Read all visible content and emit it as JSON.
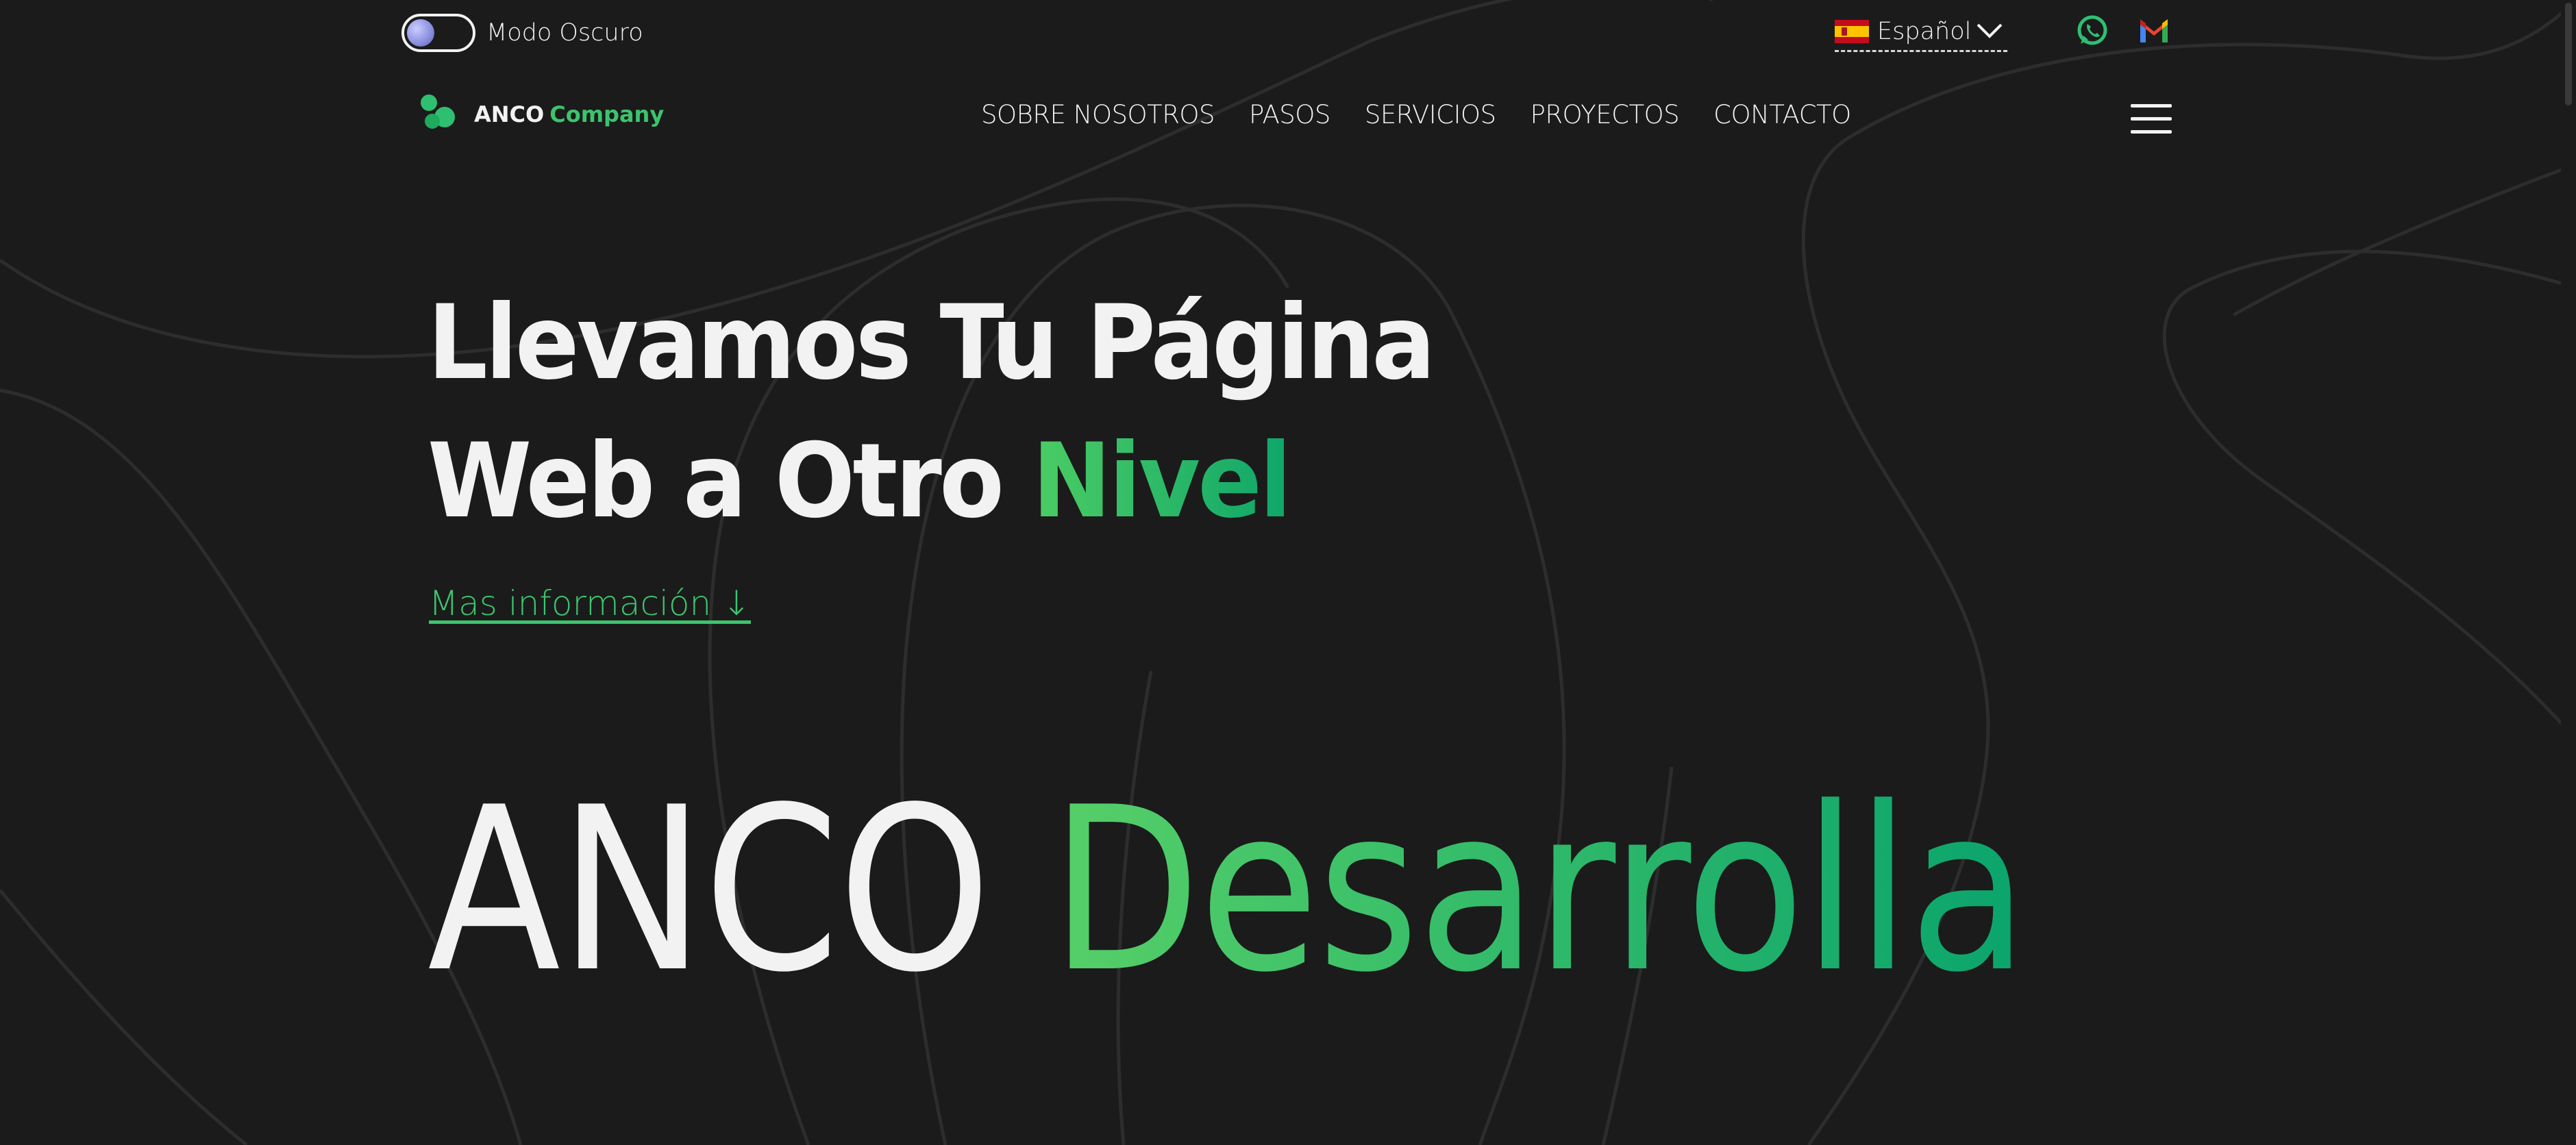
{
  "topbar": {
    "dark_mode_label": "Modo Oscuro",
    "language": "Español",
    "whatsapp_icon": "whatsapp-icon",
    "gmail_icon": "gmail-icon"
  },
  "nav": {
    "logo_first": "ANCO",
    "logo_second": "Company",
    "items": [
      "SOBRE NOSOTROS",
      "PASOS",
      "SERVICIOS",
      "PROYECTOS",
      "CONTACTO"
    ],
    "menu_icon": "hamburger-menu-icon"
  },
  "hero": {
    "line1": "Llevamos Tu Página",
    "line2_prefix": "Web a Otro",
    "line2_highlight": "Nivel",
    "more_link": "Mas información ↓",
    "big_white": "ANCO",
    "big_green": "Desarrolla"
  },
  "colors": {
    "background": "#1b1b1b",
    "accent_green": "#3cc46d",
    "accent_green_dark": "#0ea66a",
    "text": "#f2f2f2"
  }
}
